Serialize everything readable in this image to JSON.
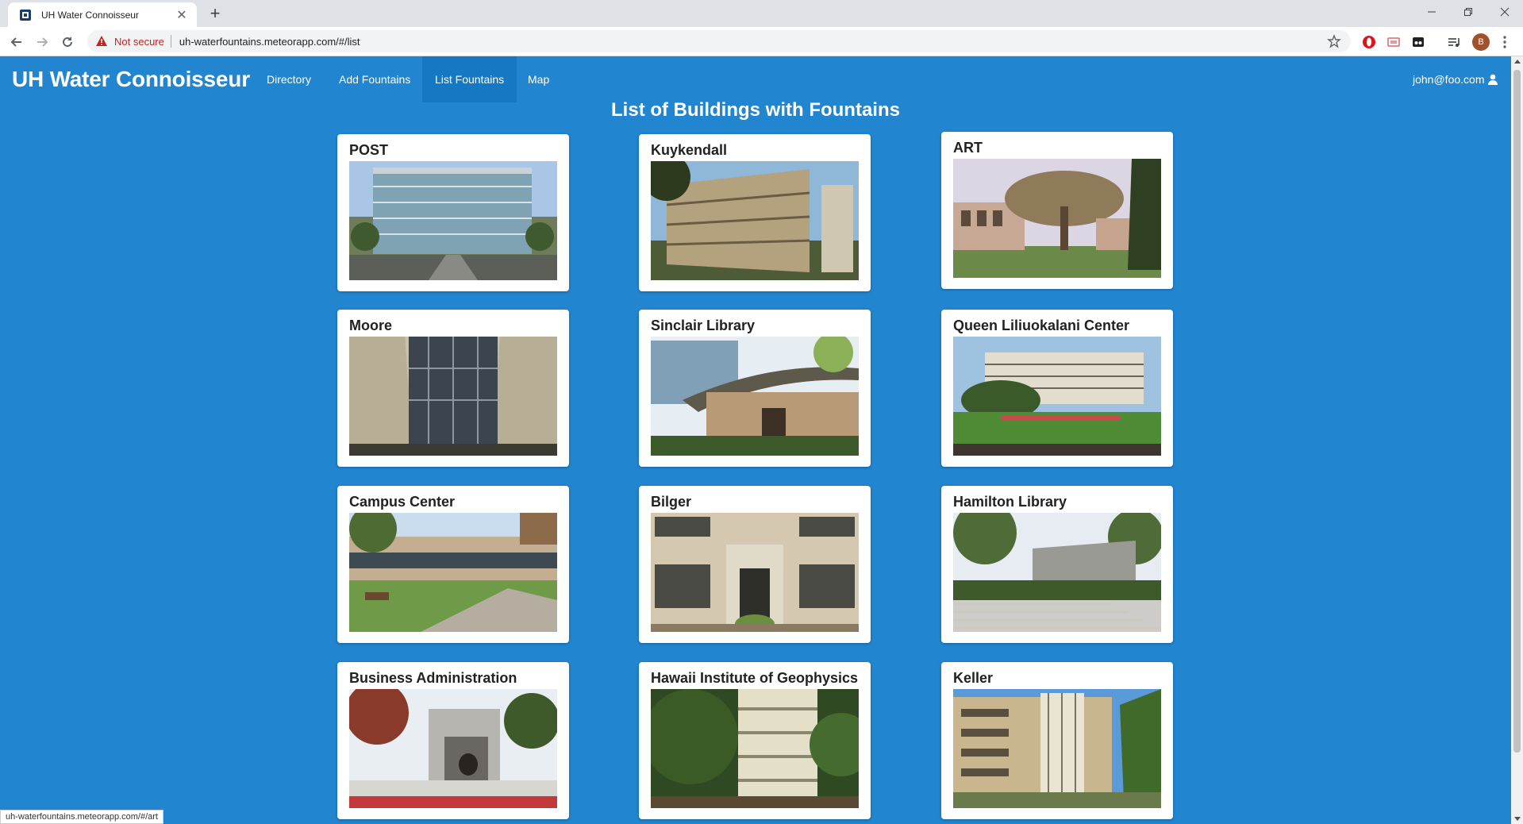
{
  "browser": {
    "tab_title": "UH Water Connoisseur",
    "not_secure_label": "Not secure",
    "url": "uh-waterfountains.meteorapp.com/#/list",
    "profile_initial": "B",
    "status_url": "uh-waterfountains.meteorapp.com/#/art"
  },
  "navbar": {
    "brand": "UH Water Connoisseur",
    "links": [
      "Directory",
      "Add Fountains",
      "List Fountains",
      "Map"
    ],
    "active_link": "List Fountains",
    "user": "john@foo.com"
  },
  "page": {
    "title": "List of Buildings with Fountains"
  },
  "buildings": [
    {
      "name": "POST"
    },
    {
      "name": "Kuykendall"
    },
    {
      "name": "ART"
    },
    {
      "name": "Moore"
    },
    {
      "name": "Sinclair Library"
    },
    {
      "name": "Queen Liliuokalani Center"
    },
    {
      "name": "Campus Center"
    },
    {
      "name": "Bilger"
    },
    {
      "name": "Hamilton Library"
    },
    {
      "name": "Business Administration"
    },
    {
      "name": "Hawaii Institute of Geophysics"
    },
    {
      "name": "Keller"
    }
  ],
  "colors": {
    "page_background": "#2185d0",
    "active_nav": "#1678c2",
    "card_background": "#ffffff"
  }
}
